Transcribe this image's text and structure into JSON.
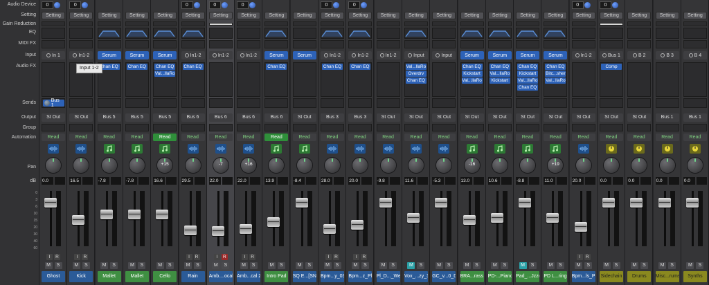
{
  "labels": [
    "Audio Device",
    "Setting",
    "Gain Reduction",
    "EQ",
    "MIDI FX",
    "Input",
    "Audio FX",
    "Sends",
    "Output",
    "Group",
    "Automation",
    "Pan",
    "dB"
  ],
  "tooltip": "Input 1-2",
  "scale": [
    "0",
    "3",
    "6",
    "10",
    "15",
    "20",
    "30",
    "40",
    "60"
  ],
  "strips": [
    {
      "name": "Ghost",
      "color": "audio",
      "dev": "0",
      "input": "In 1",
      "inType": "plain",
      "fx": [],
      "send": "Bus 1",
      "output": "St Out",
      "auto": "Read",
      "autoOn": false,
      "icon": "audio",
      "pan": "",
      "db": "0.0",
      "fader": 0.15,
      "ir": true,
      "rec": false,
      "mute": false,
      "eq": false,
      "eqGain": false,
      "sel": false
    },
    {
      "name": "Kick",
      "color": "audio",
      "dev": "0",
      "input": "In1-2",
      "inType": "plain",
      "fx": [],
      "send": "",
      "output": "St Out",
      "auto": "Read",
      "autoOn": false,
      "icon": "audio",
      "pan": "",
      "db": "16.5",
      "fader": 0.55,
      "ir": true,
      "rec": false,
      "mute": false,
      "eq": false,
      "eqGain": false,
      "sel": false
    },
    {
      "name": "Mallet",
      "color": "inst",
      "dev": "",
      "input": "Serum",
      "inType": "blue",
      "fx": [
        "Chan EQ"
      ],
      "send": "",
      "output": "Bus 5",
      "auto": "Read",
      "autoOn": false,
      "icon": "inst",
      "pan": "",
      "db": "-7.8",
      "fader": 0.42,
      "ir": false,
      "rec": false,
      "mute": false,
      "eq": true,
      "eqGain": false,
      "sel": false
    },
    {
      "name": "Mallet",
      "color": "inst",
      "dev": "",
      "input": "Serum",
      "inType": "blue",
      "fx": [
        "Chan EQ"
      ],
      "send": "",
      "output": "Bus 5",
      "auto": "Read",
      "autoOn": false,
      "icon": "inst",
      "pan": "",
      "db": "-7.8",
      "fader": 0.42,
      "ir": false,
      "rec": false,
      "mute": false,
      "eq": true,
      "eqGain": false,
      "sel": false
    },
    {
      "name": "Cello",
      "color": "inst",
      "dev": "",
      "input": "Serum",
      "inType": "blue",
      "fx": [
        "Chan EQ",
        "Val...llaRo"
      ],
      "send": "",
      "output": "Bus 5",
      "auto": "Read",
      "autoOn": true,
      "icon": "inst",
      "pan": "+15",
      "db": "16.6",
      "fader": 0.42,
      "ir": false,
      "rec": false,
      "mute": false,
      "eq": true,
      "eqGain": false,
      "sel": false
    },
    {
      "name": "Rain",
      "color": "audio",
      "dev": "0",
      "input": "In1-2",
      "inType": "plain",
      "fx": [
        "Chan EQ"
      ],
      "send": "",
      "output": "Bus 6",
      "auto": "Read",
      "autoOn": false,
      "icon": "audio",
      "pan": "",
      "db": "29.5",
      "fader": 0.78,
      "ir": true,
      "rec": false,
      "mute": false,
      "eq": true,
      "eqGain": false,
      "sel": false
    },
    {
      "name": "Amb....ocal",
      "color": "audio",
      "dev": "0",
      "input": "In1-2",
      "inType": "plain",
      "fx": [],
      "send": "",
      "output": "Bus 6",
      "auto": "Read",
      "autoOn": false,
      "icon": "audio",
      "pan": "-7",
      "db": "22.0",
      "fader": 0.8,
      "ir": true,
      "rec": true,
      "mute": false,
      "eq": false,
      "eqGain": true,
      "sel": true
    },
    {
      "name": "Amb...cal 2",
      "color": "audio",
      "dev": "0",
      "input": "In1-2",
      "inType": "plain",
      "fx": [],
      "send": "",
      "output": "Bus 6",
      "auto": "Read",
      "autoOn": false,
      "icon": "audio",
      "pan": "+16",
      "db": "22.0",
      "fader": 0.75,
      "ir": true,
      "rec": false,
      "mute": false,
      "eq": false,
      "eqGain": false,
      "sel": false
    },
    {
      "name": "Intro Pad",
      "color": "inst",
      "dev": "",
      "input": "Serum",
      "inType": "blue",
      "fx": [
        "Chan EQ"
      ],
      "send": "",
      "output": "Bus 6",
      "auto": "Read",
      "autoOn": true,
      "icon": "inst",
      "pan": "",
      "db": "13.9",
      "fader": 0.6,
      "ir": false,
      "rec": false,
      "mute": false,
      "eq": true,
      "eqGain": false,
      "sel": false
    },
    {
      "name": "SQ E...[SN",
      "color": "audio",
      "dev": "",
      "input": "Serum",
      "inType": "blue",
      "fx": [],
      "send": "",
      "output": "St Out",
      "auto": "Read",
      "autoOn": false,
      "icon": "inst",
      "pan": "",
      "db": "-8.4",
      "fader": 0.15,
      "ir": false,
      "rec": false,
      "mute": false,
      "eq": false,
      "eqGain": false,
      "sel": false
    },
    {
      "name": "Bpm...y_03",
      "color": "audio",
      "dev": "0",
      "input": "In1-2",
      "inType": "plain",
      "fx": [
        "Chan EQ"
      ],
      "send": "",
      "output": "Bus 3",
      "auto": "Read",
      "autoOn": false,
      "icon": "audio",
      "pan": "",
      "db": "28.0",
      "fader": 0.75,
      "ir": true,
      "rec": false,
      "mute": false,
      "eq": true,
      "eqGain": false,
      "sel": false
    },
    {
      "name": "Bpm...z_Pl",
      "color": "audio",
      "dev": "0",
      "input": "In1-2",
      "inType": "plain",
      "fx": [
        "Chan EQ"
      ],
      "send": "",
      "output": "Bus 3",
      "auto": "Read",
      "autoOn": false,
      "icon": "audio",
      "pan": "",
      "db": "20.0",
      "fader": 0.65,
      "ir": true,
      "rec": false,
      "mute": false,
      "eq": true,
      "eqGain": false,
      "sel": false
    },
    {
      "name": "Pl_D..._Wet",
      "color": "audio",
      "dev": "",
      "input": "In1-2",
      "inType": "plain",
      "fx": [],
      "send": "",
      "output": "St Out",
      "auto": "Read",
      "autoOn": false,
      "icon": "audio",
      "pan": "",
      "db": "-9.8",
      "fader": 0.15,
      "ir": false,
      "rec": false,
      "mute": false,
      "eq": false,
      "eqGain": false,
      "sel": false
    },
    {
      "name": "Vox_...zy_3",
      "color": "audio",
      "dev": "",
      "input": "Input",
      "inType": "plain",
      "fx": [
        "Val...llaRo",
        "Overdrv",
        "Chan EQ"
      ],
      "send": "",
      "output": "St Out",
      "auto": "Read",
      "autoOn": false,
      "icon": "audio",
      "pan": "",
      "db": "11.6",
      "fader": 0.5,
      "ir": false,
      "rec": false,
      "mute": true,
      "eq": true,
      "eqGain": false,
      "sel": false
    },
    {
      "name": "GC_v...0_D",
      "color": "audio",
      "dev": "",
      "input": "Input",
      "inType": "plain",
      "fx": [],
      "send": "",
      "output": "St Out",
      "auto": "Read",
      "autoOn": false,
      "icon": "audio",
      "pan": "",
      "db": "-5.3",
      "fader": 0.15,
      "ir": false,
      "rec": false,
      "mute": false,
      "eq": false,
      "eqGain": false,
      "sel": false
    },
    {
      "name": "BRA...rass 1",
      "color": "inst",
      "dev": "",
      "input": "Serum",
      "inType": "blue",
      "fx": [
        "Chan EQ",
        "Kickstart",
        "Val...llaRo"
      ],
      "send": "",
      "output": "St Out",
      "auto": "Read",
      "autoOn": false,
      "icon": "inst",
      "pan": "-16",
      "db": "13.0",
      "fader": 0.55,
      "ir": false,
      "rec": false,
      "mute": false,
      "eq": true,
      "eqGain": false,
      "sel": false
    },
    {
      "name": "PD-...Piano",
      "color": "inst",
      "dev": "",
      "input": "Serum",
      "inType": "blue",
      "fx": [
        "Chan EQ",
        "Val...llaRo",
        "Kickstart"
      ],
      "send": "",
      "output": "St Out",
      "auto": "Read",
      "autoOn": false,
      "icon": "inst",
      "pan": "",
      "db": "10.6",
      "fader": 0.5,
      "ir": false,
      "rec": false,
      "mute": false,
      "eq": true,
      "eqGain": false,
      "sel": false
    },
    {
      "name": "Pad_...Jzzer",
      "color": "inst",
      "dev": "",
      "input": "Serum",
      "inType": "blue",
      "fx": [
        "Chan EQ",
        "Kickstart",
        "Val...llaRo",
        "Chan EQ"
      ],
      "send": "",
      "output": "St Out",
      "auto": "Read",
      "autoOn": false,
      "icon": "inst",
      "pan": "",
      "db": "-8.8",
      "fader": 0.15,
      "ir": false,
      "rec": false,
      "mute": true,
      "eq": true,
      "eqGain": false,
      "sel": false
    },
    {
      "name": "PD L...rings",
      "color": "inst",
      "dev": "",
      "input": "Serum",
      "inType": "blue",
      "fx": [
        "Chan EQ",
        "Bitc...sher",
        "Val...llaRo"
      ],
      "send": "",
      "output": "St Out",
      "auto": "Read",
      "autoOn": false,
      "icon": "inst",
      "pan": "+19",
      "db": "11.0",
      "fader": 0.5,
      "ir": false,
      "rec": false,
      "mute": false,
      "eq": true,
      "eqGain": false,
      "sel": false
    },
    {
      "name": "Bpm...ls_Pl",
      "color": "audio",
      "dev": "0",
      "input": "In1-2",
      "inType": "plain",
      "fx": [],
      "send": "",
      "output": "St Out",
      "auto": "Read",
      "autoOn": false,
      "icon": "audio",
      "pan": "",
      "db": "20.0",
      "fader": 0.7,
      "ir": true,
      "rec": false,
      "mute": false,
      "eq": false,
      "eqGain": false,
      "sel": false
    },
    {
      "name": "Sidechain",
      "color": "aux",
      "dev": "0",
      "input": "Bus 1",
      "inType": "plain",
      "fx": [
        "Comp"
      ],
      "send": "",
      "output": "St Out",
      "auto": "Read",
      "autoOn": false,
      "icon": "aux",
      "pan": "",
      "db": "0.0",
      "fader": 0.15,
      "ir": false,
      "rec": false,
      "mute": false,
      "eq": false,
      "eqGain": true,
      "sel": false
    },
    {
      "name": "Drums",
      "color": "aux",
      "dev": "",
      "input": "B 2",
      "inType": "plain",
      "fx": [],
      "send": "",
      "output": "St Out",
      "auto": "Read",
      "autoOn": false,
      "icon": "aux",
      "pan": "",
      "db": "0.0",
      "fader": 0.15,
      "ir": false,
      "rec": false,
      "mute": false,
      "eq": false,
      "eqGain": false,
      "sel": false
    },
    {
      "name": "Misc...rums",
      "color": "aux",
      "dev": "",
      "input": "B 3",
      "inType": "plain",
      "fx": [],
      "send": "",
      "output": "Bus 1",
      "auto": "Read",
      "autoOn": false,
      "icon": "aux",
      "pan": "",
      "db": "0.0",
      "fader": 0.15,
      "ir": false,
      "rec": false,
      "mute": false,
      "eq": false,
      "eqGain": false,
      "sel": false
    },
    {
      "name": "Synths",
      "color": "aux",
      "dev": "",
      "input": "B 4",
      "inType": "plain",
      "fx": [],
      "send": "",
      "output": "Bus 1",
      "auto": "Read",
      "autoOn": false,
      "icon": "aux",
      "pan": "",
      "db": "0.0",
      "fader": 0.15,
      "ir": false,
      "rec": false,
      "mute": false,
      "eq": false,
      "eqGain": false,
      "sel": false
    }
  ]
}
